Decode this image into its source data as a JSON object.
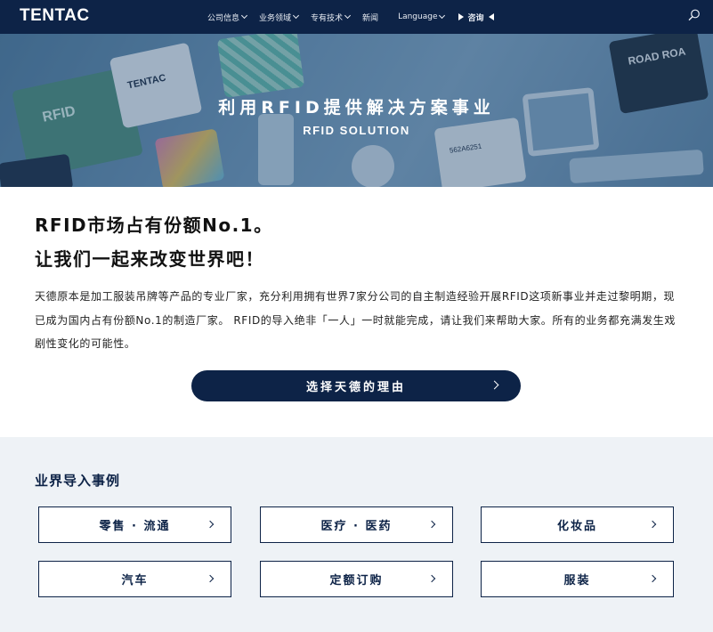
{
  "header": {
    "logo": "TENTAC",
    "nav": [
      {
        "label": "公司信息",
        "dropdown": true
      },
      {
        "label": "业务领域",
        "dropdown": true
      },
      {
        "label": "专有技术",
        "dropdown": true
      },
      {
        "label": "新闻",
        "dropdown": false
      },
      {
        "label": "Language",
        "dropdown": true
      }
    ],
    "contact_label": "咨询"
  },
  "hero": {
    "title": "利用RFID提供解决方案事业",
    "subtitle": "RFID SOLUTION",
    "card_texts": {
      "rfid": "RFID",
      "tentac": "TENTAC",
      "road": "ROAD ROA",
      "code": "562A6251"
    }
  },
  "intro": {
    "heading_line1": "RFID市场占有份额No.1。",
    "heading_line2": "让我们一起来改变世界吧！",
    "body": "天德原本是加工服装吊牌等产品的专业厂家，充分利用拥有世界7家分公司的自主制造经验开展RFID这项新事业并走过黎明期，现已成为国内占有份额No.1的制造厂家。 RFID的导入绝非「一人」一时就能完成，请让我们来帮助大家。所有的业务都充满发生戏剧性变化的可能性。",
    "cta_label": "选择天德的理由"
  },
  "cases": {
    "title": "业界导入事例",
    "items": [
      "零售 · 流通",
      "医疗 · 医药",
      "化妆品",
      "汽车",
      "定额订购",
      "服装"
    ]
  },
  "colors": {
    "navy": "#0d2347",
    "section_bg": "#eef2f6",
    "hero_tint": "#6a93b5"
  }
}
